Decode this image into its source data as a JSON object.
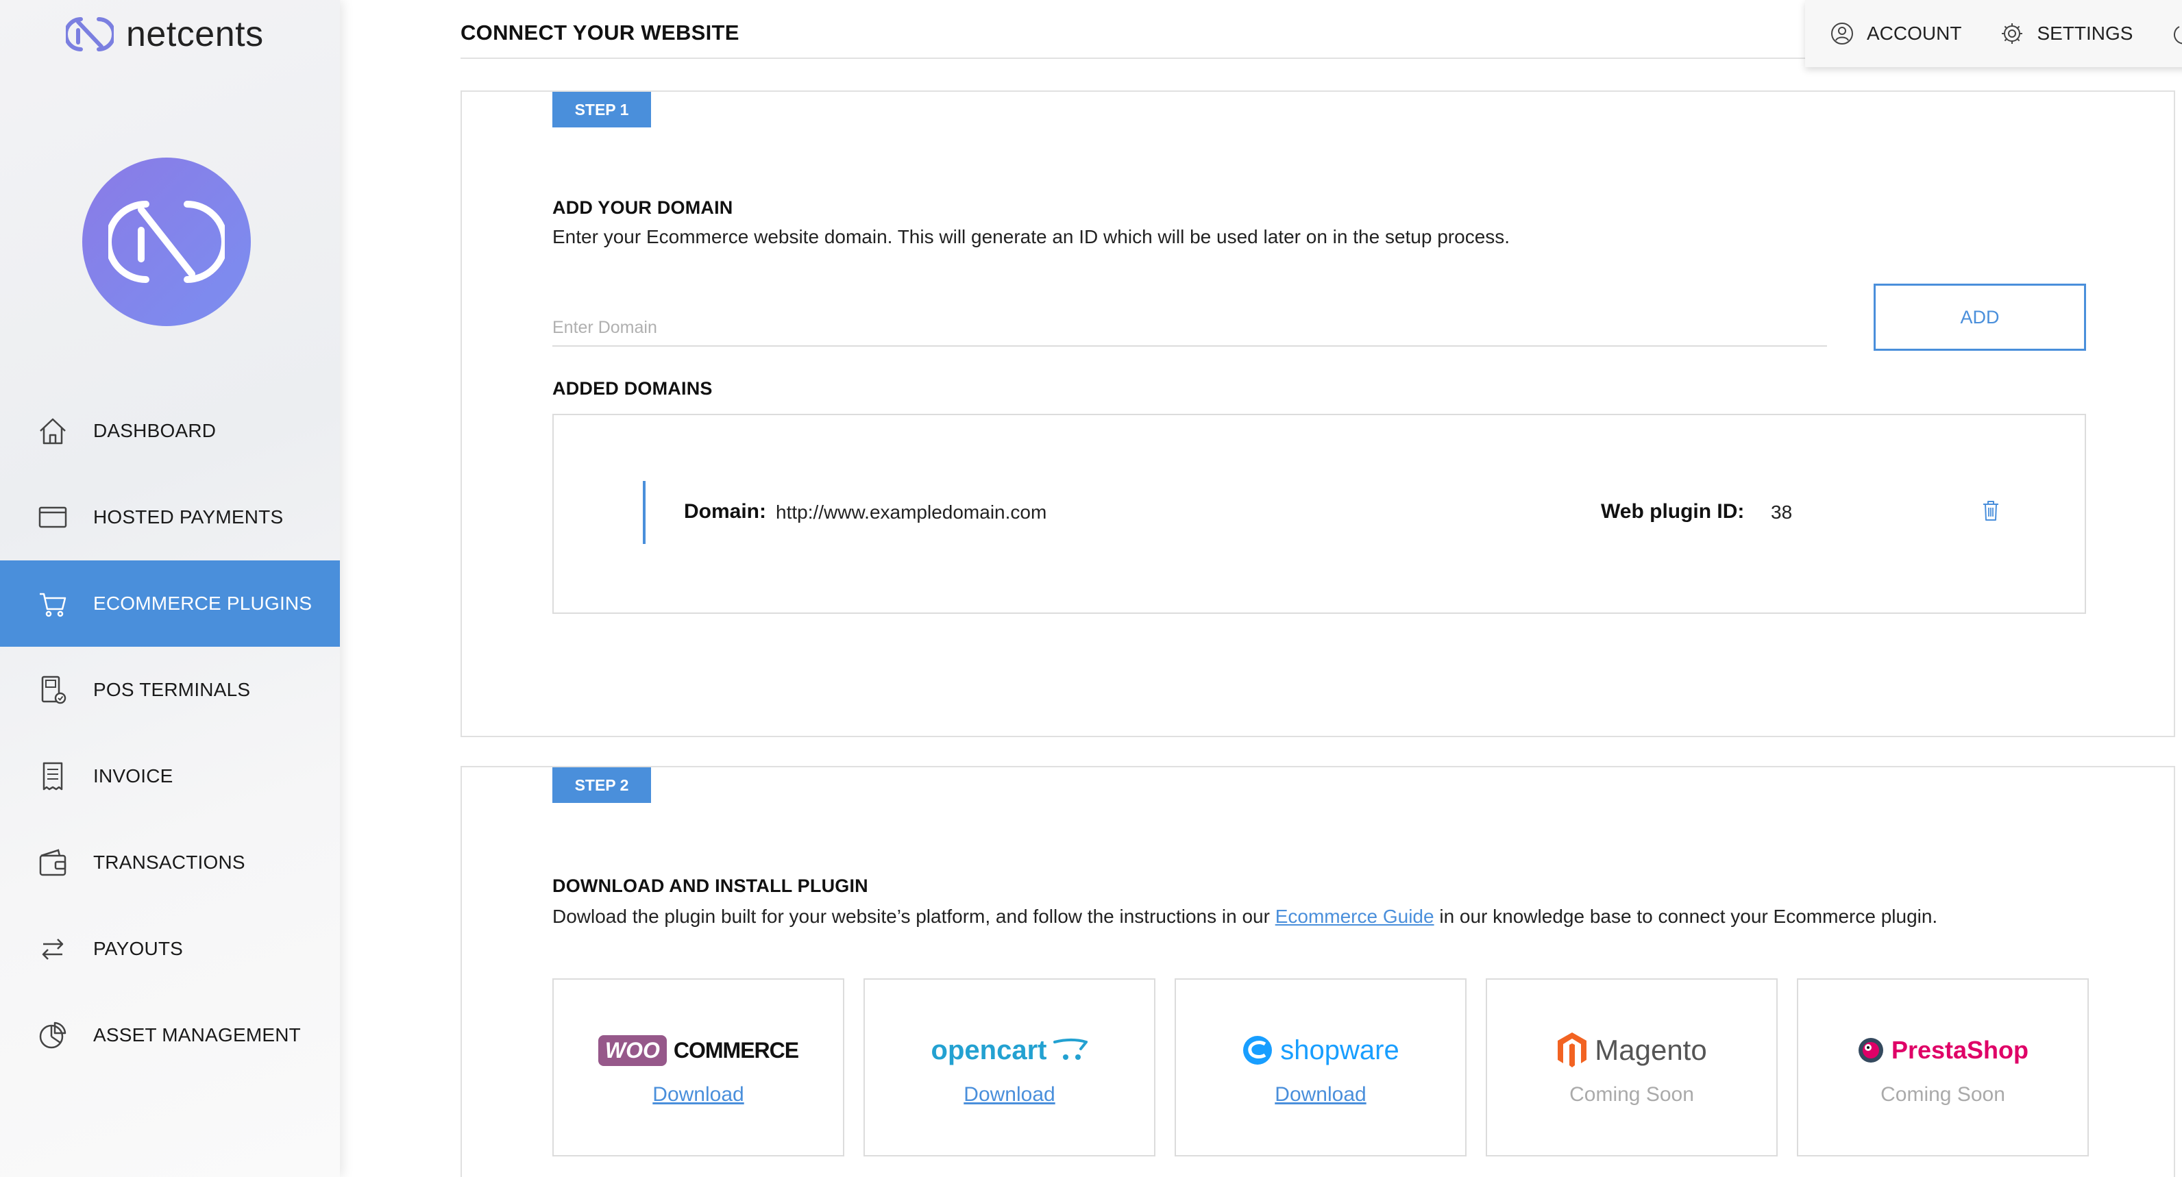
{
  "brand": {
    "name": "netcents",
    "accent": "#4a8fdb",
    "avatar_gradient": [
      "#8a7be6",
      "#7b8ef0"
    ]
  },
  "sidebar": {
    "items": [
      {
        "label": "DASHBOARD",
        "icon": "home-icon"
      },
      {
        "label": "HOSTED PAYMENTS",
        "icon": "browser-window-icon"
      },
      {
        "label": "ECOMMERCE PLUGINS",
        "icon": "cart-icon",
        "active": true
      },
      {
        "label": "POS TERMINALS",
        "icon": "pos-terminal-icon"
      },
      {
        "label": "INVOICE",
        "icon": "invoice-icon"
      },
      {
        "label": "TRANSACTIONS",
        "icon": "wallet-icon"
      },
      {
        "label": "PAYOUTS",
        "icon": "transfer-arrows-icon"
      },
      {
        "label": "ASSET MANAGEMENT",
        "icon": "pie-chart-icon"
      }
    ]
  },
  "header": {
    "title": "CONNECT YOUR WEBSITE",
    "account_label": "ACCOUNT",
    "settings_label": "SETTINGS"
  },
  "step1": {
    "badge": "STEP 1",
    "heading": "ADD YOUR DOMAIN",
    "description": "Enter your Ecommerce website domain. This will generate an ID which will be used later on in the setup process.",
    "input_placeholder": "Enter Domain",
    "input_value": "",
    "add_button": "ADD",
    "added_heading": "ADDED DOMAINS",
    "domains": [
      {
        "domain_label": "Domain:",
        "domain": "http://www.exampledomain.com",
        "plugin_id_label": "Web plugin ID:",
        "plugin_id": "38"
      }
    ]
  },
  "step2": {
    "badge": "STEP 2",
    "heading": "DOWNLOAD AND INSTALL PLUGIN",
    "desc_before": "Dowload the plugin built for your website’s platform, and follow the instructions in our ",
    "desc_link": "Ecommerce Guide",
    "desc_after": " in our knowledge base to connect your Ecommerce plugin.",
    "plugins": [
      {
        "brand_a": "WOO",
        "brand_b": "COMMERCE",
        "action": "Download"
      },
      {
        "brand": "opencart",
        "action": "Download"
      },
      {
        "brand": "shopware",
        "action": "Download"
      },
      {
        "brand": "Magento",
        "action": "Coming Soon"
      },
      {
        "brand": "PrestaShop",
        "action": "Coming Soon"
      }
    ]
  }
}
